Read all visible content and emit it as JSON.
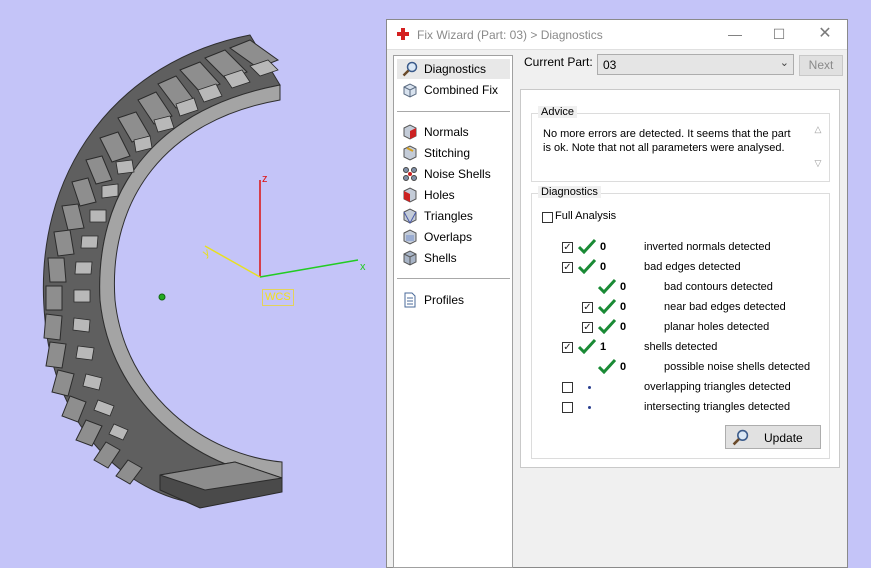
{
  "viewport": {
    "wcs_label": "WCS"
  },
  "dialog": {
    "title": "Fix Wizard (Part: 03) > Diagnostics",
    "window_buttons": {
      "minimize": "—",
      "maximize": "☐",
      "close": "✕"
    }
  },
  "nav": {
    "top": [
      {
        "label": "Diagnostics",
        "icon": "magnifier-icon"
      },
      {
        "label": "Combined Fix",
        "icon": "box-icon"
      }
    ],
    "tools": [
      {
        "label": "Normals",
        "icon": "normals-cube-icon"
      },
      {
        "label": "Stitching",
        "icon": "stitching-cube-icon"
      },
      {
        "label": "Noise Shells",
        "icon": "noise-shells-icon"
      },
      {
        "label": "Holes",
        "icon": "holes-cube-icon"
      },
      {
        "label": "Triangles",
        "icon": "triangles-cube-icon"
      },
      {
        "label": "Overlaps",
        "icon": "overlaps-cube-icon"
      },
      {
        "label": "Shells",
        "icon": "shells-cube-icon"
      }
    ],
    "bottom": [
      {
        "label": "Profiles",
        "icon": "document-icon"
      }
    ]
  },
  "current_part": {
    "label": "Current Part:",
    "value": "03",
    "next_label": "Next"
  },
  "advice": {
    "title": "Advice",
    "text": "No more errors are detected. It seems that the part is ok. Note that not all parameters were analysed."
  },
  "diagnostics": {
    "title": "Diagnostics",
    "full_analysis": {
      "label": "Full Analysis",
      "checked": false
    },
    "rows": [
      {
        "label": "inverted normals detected",
        "count": "0",
        "checked": true
      },
      {
        "label": "bad edges detected",
        "count": "0",
        "checked": true
      },
      {
        "label": "bad contours detected",
        "count": "0"
      },
      {
        "label": "near bad edges detected",
        "count": "0",
        "checked": true
      },
      {
        "label": "planar holes detected",
        "count": "0",
        "checked": true
      },
      {
        "label": "shells detected",
        "count": "1",
        "checked": true
      },
      {
        "label": "possible noise shells detected",
        "count": "0"
      },
      {
        "label": "overlapping triangles detected",
        "count": "",
        "checked": false
      },
      {
        "label": "intersecting triangles detected",
        "count": "",
        "checked": false
      }
    ],
    "update_label": "Update"
  },
  "colors": {
    "viewport_bg": "#c4c4f8",
    "check_green": "#1a8a35",
    "axis_x": "#22cc22",
    "axis_y": "#e8e020",
    "axis_z": "#dd1111"
  }
}
